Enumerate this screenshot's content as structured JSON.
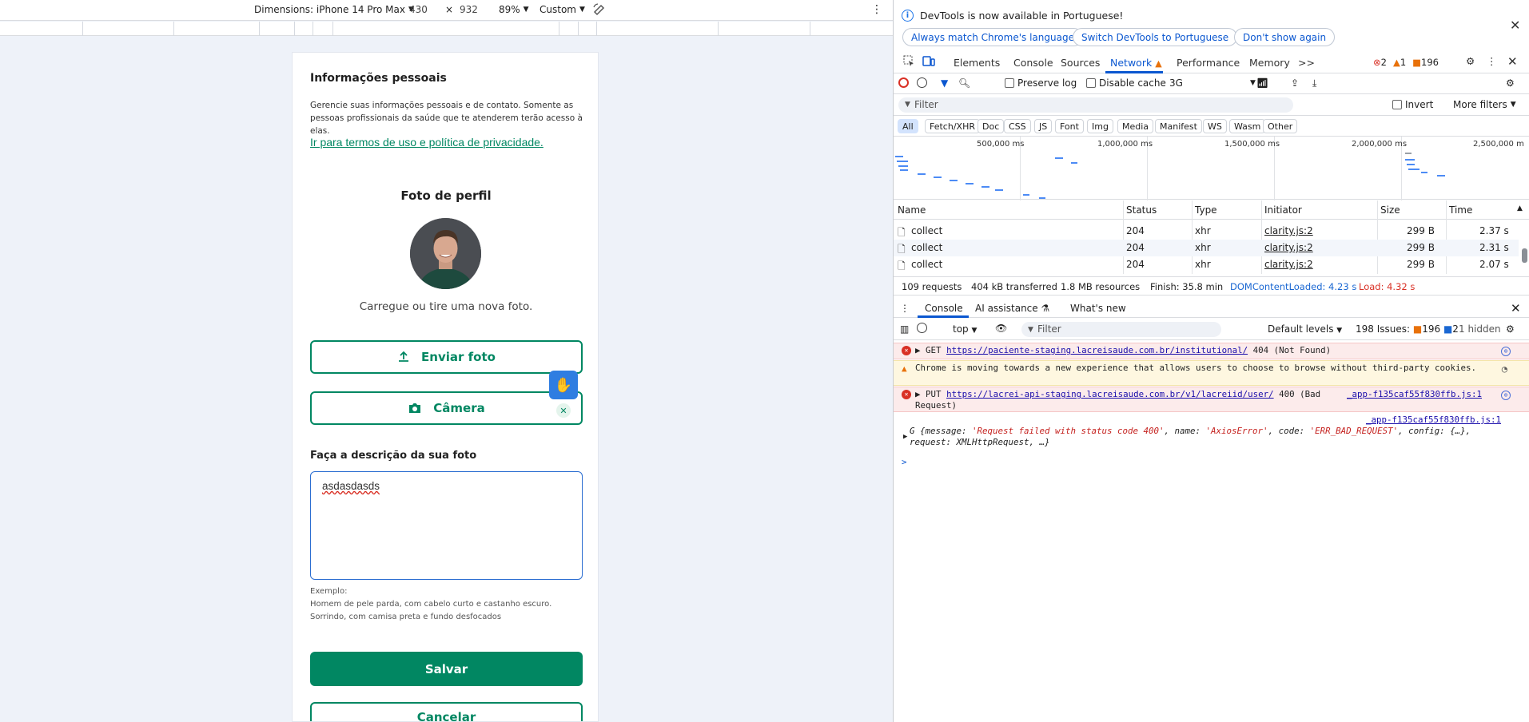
{
  "device_toolbar": {
    "dimensions_label": "Dimensions: iPhone 14 Pro Max",
    "width": "430",
    "times": "×",
    "height": "932",
    "zoom": "89%",
    "throttle": "Custom"
  },
  "page": {
    "title": "Informações pessoais",
    "description": "Gerencie suas informações pessoais e de contato. Somente as pessoas profissionais da saúde que te atenderem terão acesso à elas.",
    "terms_link": "Ir para termos de uso e política de privacidade.",
    "photo_title": "Foto de perfil",
    "photo_hint": "Carregue ou tire uma nova foto.",
    "send_photo": "Enviar foto",
    "camera": "Câmera",
    "description_label": "Faça a descrição da sua foto",
    "description_value": "asdasdasds",
    "example_label": "Exemplo:",
    "example_text": "Homem de pele parda, com cabelo curto e castanho escuro. Sorrindo, com camisa preta e fundo desfocados",
    "save": "Salvar",
    "cancel": "Cancelar"
  },
  "devtools": {
    "info_message": "DevTools is now available in Portuguese!",
    "btn_match": "Always match Chrome's language",
    "btn_switch": "Switch DevTools to Portuguese",
    "btn_dont_show": "Don't show again",
    "tabs": [
      "Elements",
      "Console",
      "Sources",
      "Network",
      "Performance",
      "Memory"
    ],
    "more_tabs": ">>",
    "errors_count": "2",
    "warnings_count": "1",
    "issues_count": "196",
    "preserve_log": "Preserve log",
    "disable_cache": "Disable cache",
    "throttling": "3G",
    "filter_placeholder": "Filter",
    "invert": "Invert",
    "more_filters": "More filters",
    "type_filters": [
      "All",
      "Fetch/XHR",
      "Doc",
      "CSS",
      "JS",
      "Font",
      "Img",
      "Media",
      "Manifest",
      "WS",
      "Wasm",
      "Other"
    ],
    "overview_labels": [
      "500,000 ms",
      "1,000,000 ms",
      "1,500,000 ms",
      "2,000,000 ms",
      "2,500,000 m"
    ],
    "columns": [
      "Name",
      "Status",
      "Type",
      "Initiator",
      "Size",
      "Time"
    ],
    "rows": [
      {
        "name": "collect",
        "status": "204",
        "type": "xhr",
        "initiator": "clarity.js:2",
        "size": "299 B",
        "time": "2.37 s"
      },
      {
        "name": "collect",
        "status": "204",
        "type": "xhr",
        "initiator": "clarity.js:2",
        "size": "299 B",
        "time": "2.31 s"
      },
      {
        "name": "collect",
        "status": "204",
        "type": "xhr",
        "initiator": "clarity.js:2",
        "size": "299 B",
        "time": "2.07 s"
      }
    ],
    "summary": {
      "requests": "109 requests",
      "transferred": "404 kB transferred",
      "resources": "1.8 MB resources",
      "finish": "Finish: 35.8 min",
      "dcl": "DOMContentLoaded: 4.23 s",
      "load": "Load: 4.32 s"
    },
    "drawer_tabs": [
      "Console",
      "AI assistance",
      "What's new"
    ],
    "console": {
      "context": "top",
      "filter_placeholder": "Filter",
      "levels": "Default levels",
      "issues_label": "198 Issues:",
      "issues_warn": "196",
      "issues_info": "2",
      "hidden": "1 hidden",
      "msg1_method": "GET",
      "msg1_url": "https://paciente-staging.lacreisaude.com.br/institutional/",
      "msg1_status": "404 (Not Found)",
      "msg2": "Chrome is moving towards a new experience that allows users to choose to browse without third-party cookies.",
      "msg3_method": "PUT",
      "msg3_url": "https://lacrei-api-staging.lacreisaude.com.br/v1/lacreiid/user/",
      "msg3_status": "400 (Bad Request)",
      "msg3_source": "_app-f135caf55f830ffb.js:1",
      "msg4_source": "_app-f135caf55f830ffb.js:1",
      "msg4_line1_prefix": "G {message: ",
      "msg4_message": "'Request failed with status code 400'",
      "msg4_name_key": ", name: ",
      "msg4_name": "'AxiosError'",
      "msg4_code_key": ", code: ",
      "msg4_code": "'ERR_BAD_REQUEST'",
      "msg4_config": ", config: {…},",
      "msg4_line2": "request: XMLHttpRequest, …}",
      "prompt": ">"
    }
  },
  "colors": {
    "brand_green": "#018762",
    "devtools_blue": "#0b57d0",
    "error_red": "#d93025",
    "warning_orange": "#e8710a"
  }
}
